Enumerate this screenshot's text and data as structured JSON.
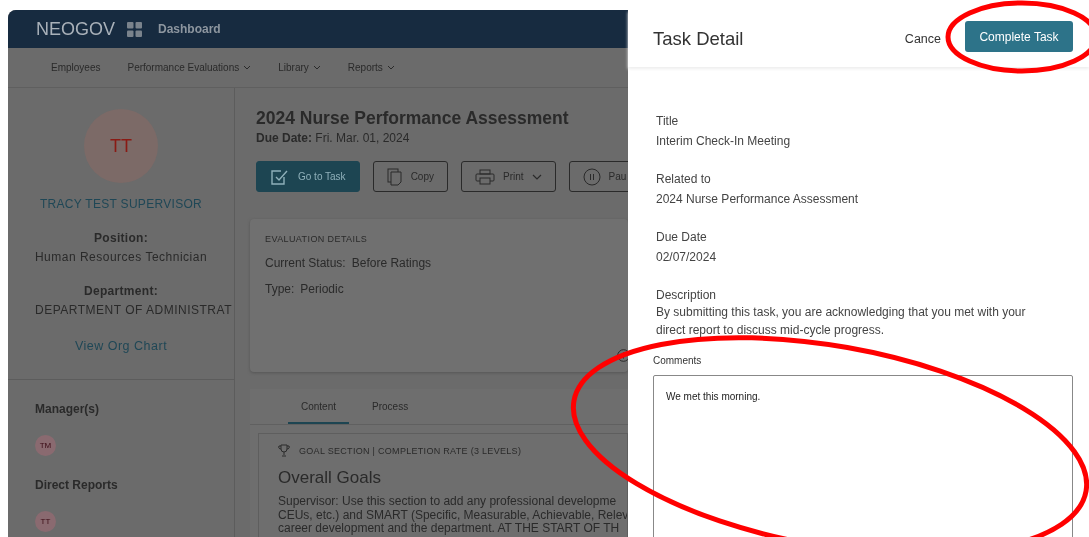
{
  "app": {
    "logo": "NEOGOV",
    "dashboard": "Dashboard",
    "nav": [
      {
        "label": "Employees",
        "dropdown": false
      },
      {
        "label": "Performance Evaluations",
        "dropdown": true
      },
      {
        "label": "Library",
        "dropdown": true
      },
      {
        "label": "Reports",
        "dropdown": true
      }
    ],
    "profile": {
      "initials": "TT",
      "name": "TRACY TEST SUPERVISOR",
      "position_label": "Position:",
      "position": "Human Resources Technician",
      "department_label": "Department:",
      "department": "DEPARTMENT OF ADMINISTRAT",
      "org_chart_link": "View Org Chart",
      "groups": [
        {
          "heading": "Manager(s)",
          "initials": "TM"
        },
        {
          "heading": "Direct Reports",
          "initials": "TT"
        }
      ]
    },
    "evaluation": {
      "title": "2024 Nurse Performance Assessment",
      "due": "**Due Date:** Fri. Mar. 01, 2024",
      "actions": [
        {
          "kind": "primary",
          "label": "Go to Task"
        },
        {
          "kind": "copy",
          "label": "Copy"
        },
        {
          "kind": "print",
          "label": "Print"
        },
        {
          "kind": "pause",
          "label": "Pau"
        }
      ],
      "details": {
        "heading": "EVALUATION DETAILS",
        "rows": [
          {
            "label": "Current Status:",
            "value": "Before Ratings"
          },
          {
            "label": "Type:",
            "value": "Periodic"
          }
        ]
      },
      "tabs": [
        {
          "label": "Content",
          "selected": true
        },
        {
          "label": "Process",
          "selected": false
        }
      ],
      "section": {
        "kicker": "GOAL SECTION | COMPLETION RATE (3 LEVELS)",
        "title": "Overall Goals",
        "lines": [
          "Supervisor: Use this section to add any professional developme",
          "CEUs, etc.) and SMART (Specific, Measurable, Achievable, Relev",
          "career development and the department. AT THE START OF TH"
        ]
      }
    }
  },
  "panel": {
    "title": "Task Detail",
    "cancel": "Cance",
    "submit": "Complete Task",
    "fields": [
      {
        "label": "Title",
        "value": "Interim Check-In Meeting"
      },
      {
        "label": "Related to",
        "value": "2024 Nurse Performance Assessment"
      },
      {
        "label": "Due Date",
        "value": "02/07/2024"
      },
      {
        "label": "Description",
        "value": "By submitting this task, you are acknowledging that you met with your direct report to discuss mid-cycle progress."
      }
    ],
    "comments": {
      "label": "Comments",
      "value": "We met this morning."
    }
  },
  "annotations": [
    {
      "kind": "ellipse"
    },
    {
      "kind": "ellipse"
    }
  ]
}
